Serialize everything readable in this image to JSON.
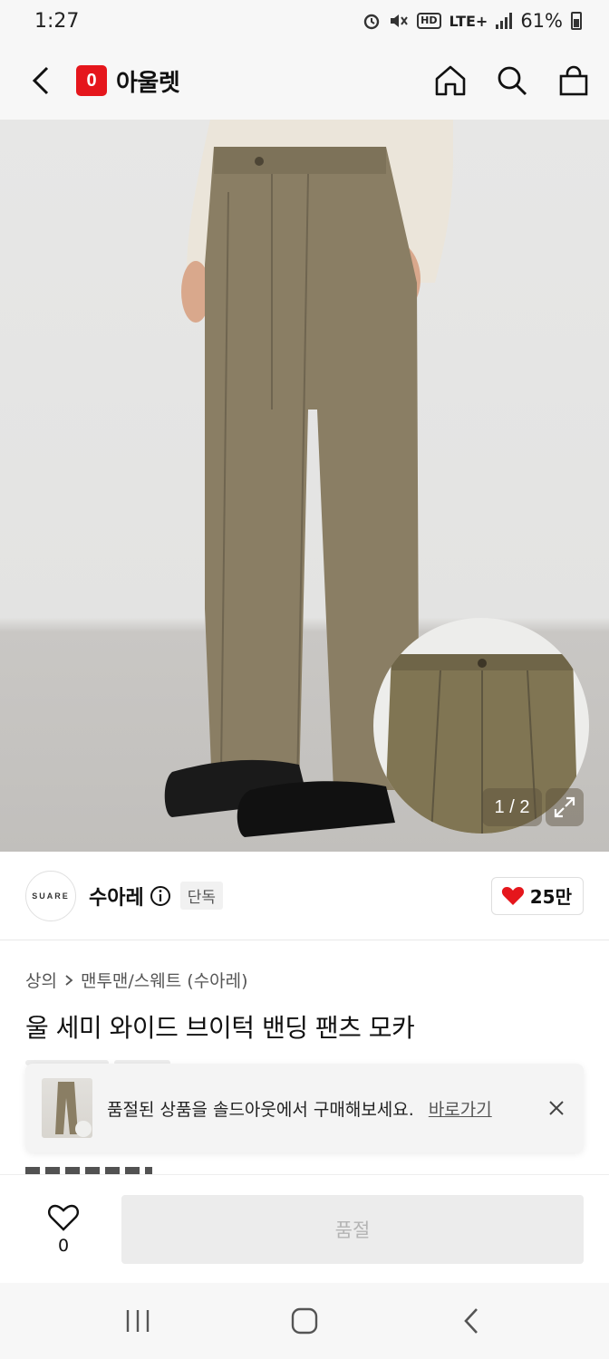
{
  "status_bar": {
    "time": "1:27",
    "network": "LTE+",
    "hd": "HD",
    "battery": "61%"
  },
  "header": {
    "app_name": "아울렛",
    "logo_letter": "0"
  },
  "gallery": {
    "page_indicator": "1 / 2"
  },
  "brand": {
    "logo_text": "SUARE",
    "name": "수아레",
    "badge": "단독",
    "like_count": "25만"
  },
  "breadcrumb": {
    "category": "상의",
    "subcategory": "맨투맨/스웨트 (수아레)"
  },
  "product": {
    "title": "울 세미 와이드 브이턱 밴딩 팬츠 모카"
  },
  "soldout_banner": {
    "message": "품절된 상품을 솔드아웃에서 구매해보세요.",
    "link_label": "바로가기"
  },
  "purchase_bar": {
    "wish_count": "0",
    "button_label": "품절"
  },
  "colors": {
    "brand_red": "#e5161c",
    "pants": "#8a7e64",
    "heart": "#e5161c"
  }
}
